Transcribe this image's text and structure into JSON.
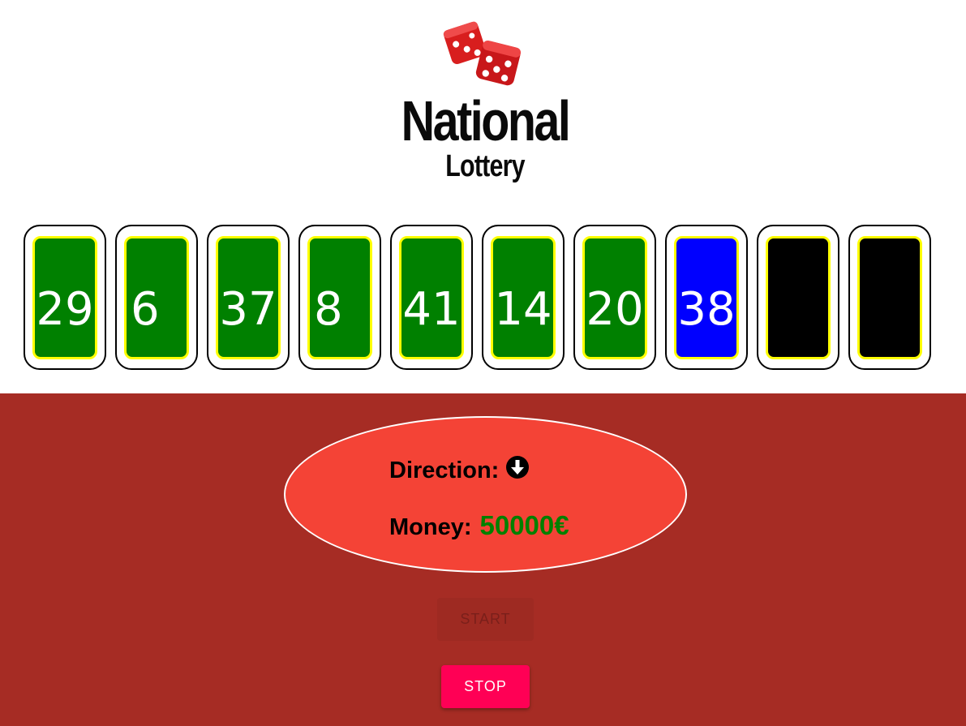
{
  "logo": {
    "title": "National",
    "subtitle": "Lottery",
    "icon": "dice-icon"
  },
  "colors": {
    "drawn": "#008000",
    "bonus": "#0000ff",
    "pending": "#000000",
    "ball_border": "#ffff00",
    "panel": "#a62c24",
    "info_panel": "#f44336",
    "money": "#008000",
    "stop_button": "#ff0055"
  },
  "balls": [
    {
      "number": "29",
      "state": "drawn",
      "align": "center"
    },
    {
      "number": "6",
      "state": "drawn",
      "align": "left"
    },
    {
      "number": "37",
      "state": "drawn",
      "align": "center"
    },
    {
      "number": "8",
      "state": "drawn",
      "align": "left"
    },
    {
      "number": "41",
      "state": "drawn",
      "align": "center"
    },
    {
      "number": "14",
      "state": "drawn",
      "align": "center"
    },
    {
      "number": "20",
      "state": "drawn",
      "align": "center"
    },
    {
      "number": "38",
      "state": "bonus",
      "align": "center"
    },
    {
      "number": "",
      "state": "pending",
      "align": "center"
    },
    {
      "number": "",
      "state": "pending",
      "align": "center"
    }
  ],
  "info": {
    "direction_label": "Direction:",
    "direction_icon": "arrow-down-circle-icon",
    "money_label": "Money:",
    "money_value": "50000€"
  },
  "buttons": {
    "start_label": "START",
    "start_enabled": false,
    "stop_label": "STOP",
    "stop_enabled": true
  }
}
